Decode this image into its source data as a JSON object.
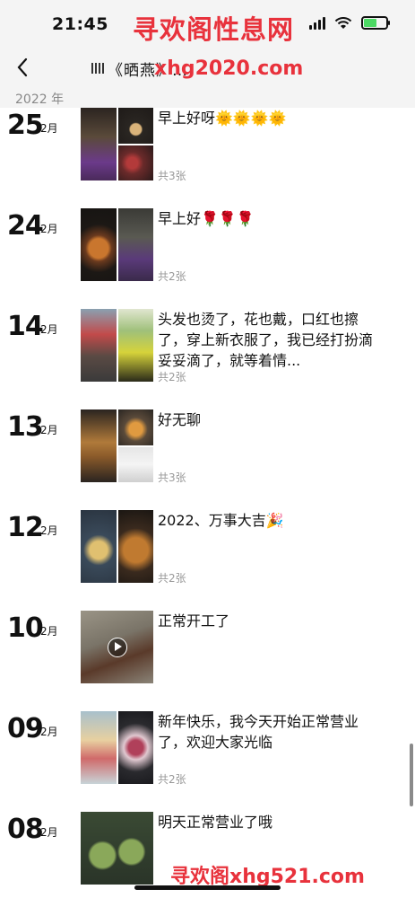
{
  "status_bar": {
    "time": "21:45",
    "battery_fill": 0.6
  },
  "nav": {
    "title": "《晒燕》…"
  },
  "watermarks": {
    "top": "寻欢阁性息网",
    "url": "xhg2020.com",
    "bottom": "寻欢阁xhg521.com"
  },
  "year_header": "2022 年",
  "entries": [
    {
      "day": "25",
      "month": "2月",
      "text": "早上好呀🌞🌞🌞🌞",
      "count": "共3张",
      "icons": [
        "coffee-table-photo",
        "tea-cup-photo",
        "tulips-photo"
      ]
    },
    {
      "day": "24",
      "month": "2月",
      "text": "早上好🌹🌹🌹",
      "count": "共2张",
      "icons": [
        "pizza-photo",
        "tulips-coffee-photo"
      ]
    },
    {
      "day": "14",
      "month": "2月",
      "text": "头发也烫了，花也戴，口红也擦了，穿上新衣服了，我已经打扮滴妥妥滴了，就等着情...",
      "count": "共2张",
      "icons": [
        "woman-photo",
        "sign-photo"
      ]
    },
    {
      "day": "13",
      "month": "2月",
      "text": "好无聊",
      "count": "共3张",
      "icons": [
        "sandwich-photo",
        "pancake-photo",
        "milk-photo"
      ]
    },
    {
      "day": "12",
      "month": "2月",
      "text": "2022、万事大吉🎉",
      "count": "共2张",
      "icons": [
        "soup-photo",
        "burger-photo"
      ]
    },
    {
      "day": "10",
      "month": "2月",
      "text": "正常开工了",
      "count": "",
      "icons": [
        "chicken-video"
      ]
    },
    {
      "day": "09",
      "month": "2月",
      "text": "新年快乐，我今天开始正常营业了，欢迎大家光临",
      "count": "共2张",
      "icons": [
        "ice-cream-photo",
        "dessert-photo"
      ]
    },
    {
      "day": "08",
      "month": "2月",
      "text": "明天正常营业了哦",
      "count": "",
      "icons": [
        "artichoke-photo"
      ]
    }
  ]
}
